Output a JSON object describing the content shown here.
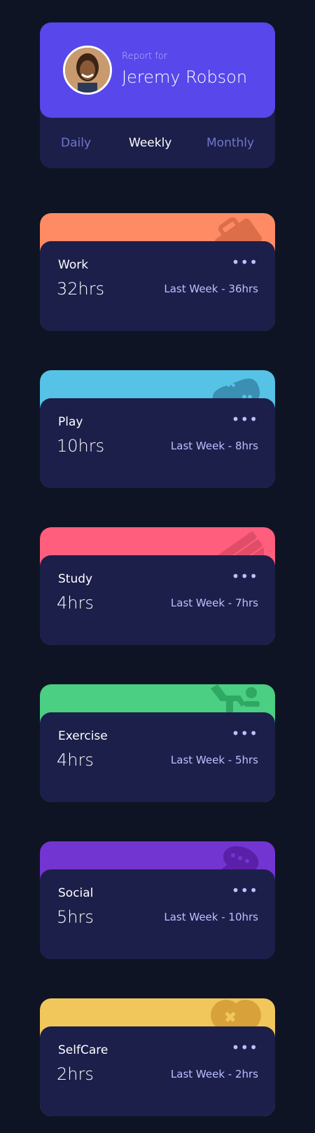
{
  "profile": {
    "report_for": "Report for",
    "name": "Jeremy Robson"
  },
  "periods": {
    "daily": "Daily",
    "weekly": "Weekly",
    "monthly": "Monthly",
    "selected": "Weekly"
  },
  "cards": [
    {
      "title": "Work",
      "current": "32hrs",
      "previous": "Last Week - 36hrs",
      "color": "#ff8b64",
      "icon": "briefcase-icon"
    },
    {
      "title": "Play",
      "current": "10hrs",
      "previous": "Last Week - 8hrs",
      "color": "#55c2e6",
      "icon": "gamepad-icon"
    },
    {
      "title": "Study",
      "current": "4hrs",
      "previous": "Last Week - 7hrs",
      "color": "#ff5e7d",
      "icon": "books-icon"
    },
    {
      "title": "Exercise",
      "current": "4hrs",
      "previous": "Last Week - 5hrs",
      "color": "#4bcf82",
      "icon": "running-person-icon"
    },
    {
      "title": "Social",
      "current": "5hrs",
      "previous": "Last Week - 10hrs",
      "color": "#7335d2",
      "icon": "chat-bubble-icon"
    },
    {
      "title": "SelfCare",
      "current": "2hrs",
      "previous": "Last Week - 2hrs",
      "color": "#f1c75b",
      "icon": "heart-icon"
    }
  ],
  "menu_glyph": "•••"
}
